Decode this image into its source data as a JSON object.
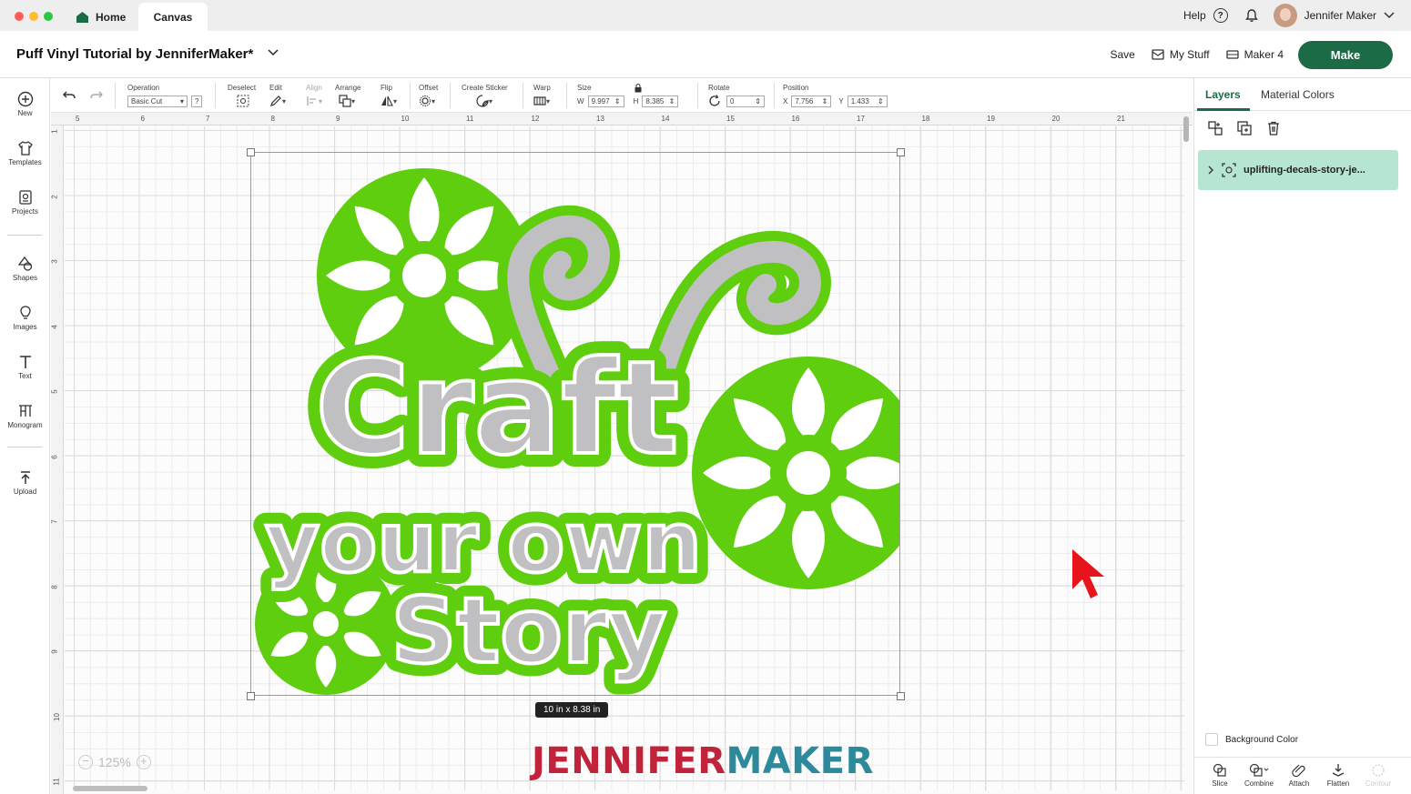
{
  "window": {
    "tabs": [
      {
        "label": "Home"
      },
      {
        "label": "Canvas"
      }
    ],
    "help_label": "Help",
    "help_glyph": "?",
    "user_name": "Jennifer Maker"
  },
  "header": {
    "project_title": "Puff Vinyl Tutorial by JenniferMaker*",
    "save_label": "Save",
    "mystuff_label": "My Stuff",
    "machine_label": "Maker 4",
    "make_label": "Make",
    "make_color": "#1a6b46"
  },
  "sidebar": {
    "items": [
      {
        "label": "New",
        "icon": "plus-circle-icon"
      },
      {
        "label": "Templates",
        "icon": "shirt-icon"
      },
      {
        "label": "Projects",
        "icon": "projects-icon"
      },
      {
        "label": "Shapes",
        "icon": "shapes-icon"
      },
      {
        "label": "Images",
        "icon": "lightbulb-icon"
      },
      {
        "label": "Text",
        "icon": "text-icon"
      },
      {
        "label": "Monogram",
        "icon": "monogram-icon"
      },
      {
        "label": "Upload",
        "icon": "upload-icon"
      }
    ]
  },
  "toolbar": {
    "operation_label": "Operation",
    "operation_value": "Basic Cut",
    "operation_help": "?",
    "deselect_label": "Deselect",
    "edit_label": "Edit",
    "align_label": "Align",
    "arrange_label": "Arrange",
    "flip_label": "Flip",
    "offset_label": "Offset",
    "sticker_label": "Create Sticker",
    "warp_label": "Warp",
    "size_label": "Size",
    "w_label": "W",
    "w_value": "9.997",
    "h_label": "H",
    "h_value": "8.385",
    "rotate_label": "Rotate",
    "rotate_value": "0",
    "position_label": "Position",
    "x_label": "X",
    "x_value": "7.756",
    "y_label": "Y",
    "y_value": "1.433"
  },
  "canvas": {
    "ruler_top": [
      "5",
      "6",
      "7",
      "8",
      "9",
      "10",
      "11",
      "12",
      "13",
      "14",
      "15",
      "16",
      "17",
      "18",
      "19",
      "20",
      "21"
    ],
    "ruler_left": [
      "1",
      "2",
      "3",
      "4",
      "5",
      "6",
      "7",
      "8",
      "9",
      "10",
      "11"
    ],
    "dimension_badge": "10  in x 8.38  in",
    "zoom_level": "125%",
    "zoom_minus": "−",
    "zoom_plus": "+",
    "design": {
      "line1": "Craft",
      "line2": "your own",
      "line3": "Story",
      "fill_color": "#c0c0c3",
      "outline_color": "#5fce0f"
    },
    "watermark_part1": "JENNIFER",
    "watermark_part2": "MAKER"
  },
  "right_panel": {
    "tabs": [
      {
        "label": "Layers"
      },
      {
        "label": "Material Colors"
      }
    ],
    "layer_name": "uplifting-decals-story-je...",
    "background_color_label": "Background Color",
    "bottom_tools": [
      {
        "label": "Slice"
      },
      {
        "label": "Combine"
      },
      {
        "label": "Attach"
      },
      {
        "label": "Flatten"
      },
      {
        "label": "Contour"
      }
    ]
  }
}
